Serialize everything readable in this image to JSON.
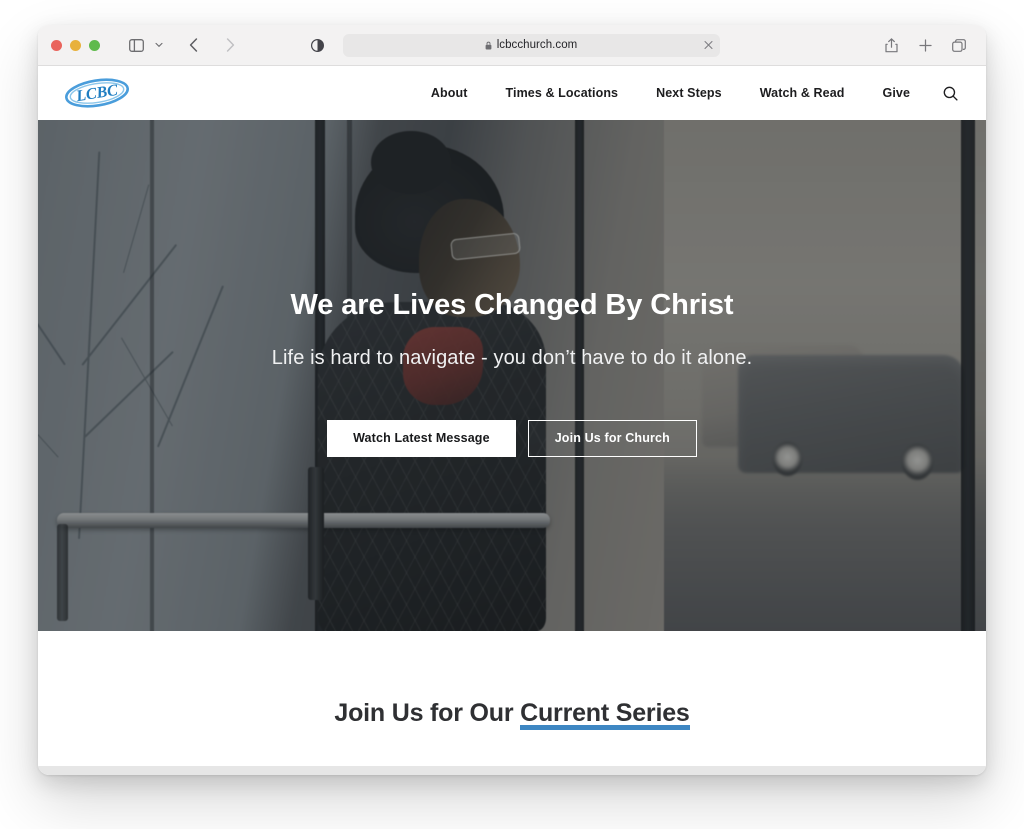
{
  "browser": {
    "name": "Safari",
    "traffic_lights": [
      {
        "name": "close",
        "color": "#e9645c"
      },
      {
        "name": "minimize",
        "color": "#e8b13c"
      },
      {
        "name": "maximize",
        "color": "#5fba4c"
      }
    ],
    "sidebar_toggle": "sidebar-icon",
    "sidebar_dropdown": "chevron-down-icon",
    "back": "back-arrow-icon",
    "forward": "forward-arrow-icon",
    "reader_icon": "reader-mode-icon",
    "address": {
      "url": "lcbcchurch.com",
      "lock": "lock-icon",
      "clear": "close-icon"
    },
    "right_tools": [
      {
        "name": "share-icon",
        "label": "Share"
      },
      {
        "name": "plus-icon",
        "label": "New Tab"
      },
      {
        "name": "tabs-icon",
        "label": "Tab Overview"
      }
    ]
  },
  "site": {
    "logo_text": "LCBC",
    "nav": [
      {
        "label": "About"
      },
      {
        "label": "Times & Locations"
      },
      {
        "label": "Next Steps"
      },
      {
        "label": "Watch & Read"
      },
      {
        "label": "Give"
      }
    ],
    "search_icon": "search-icon"
  },
  "hero": {
    "title": "We are Lives Changed By Christ",
    "subtitle": "Life is hard to navigate - you don’t have to do it alone.",
    "primary_button": "Watch Latest Message",
    "secondary_button": "Join Us for Church",
    "image_alt": "Woman with glasses smiling, seen through glass entrance doors of a church building"
  },
  "section": {
    "title_lead": "Join Us for Our ",
    "title_highlight": "Current Series",
    "highlight_color": "#3e87c3"
  }
}
